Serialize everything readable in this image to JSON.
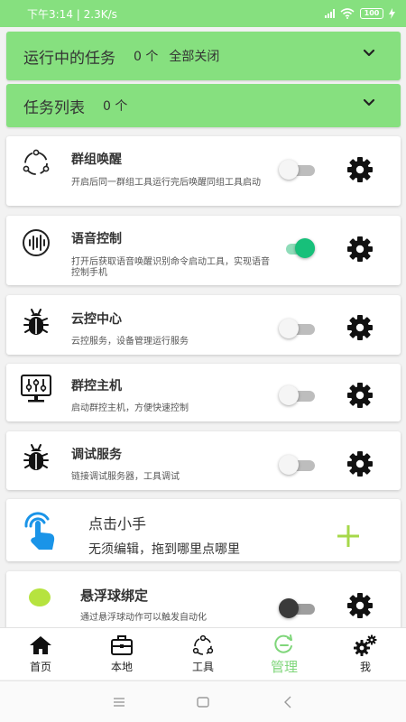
{
  "status_bar": {
    "time_speed": "下午3:14 | 2.3K/s",
    "battery": "100"
  },
  "running_tasks": {
    "title": "运行中的任务",
    "count": "0 个",
    "close_all": "全部关闭"
  },
  "task_list": {
    "title": "任务列表",
    "count": "0 个"
  },
  "cards": [
    {
      "title": "群组唤醒",
      "desc": "开启后同一群组工具运行完后唤醒同组工具启动",
      "toggle": "off",
      "icon": "group-cycle-icon"
    },
    {
      "title": "语音控制",
      "desc": "打开后获取语音唤醒识别命令启动工具，实现语音控制手机",
      "toggle": "on",
      "icon": "voice-wave-icon"
    },
    {
      "title": "云控中心",
      "desc": "云控服务，设备管理运行服务",
      "toggle": "off",
      "icon": "bug-icon"
    },
    {
      "title": "群控主机",
      "desc": "启动群控主机，方便快速控制",
      "toggle": "off",
      "icon": "monitor-sliders-icon"
    },
    {
      "title": "调试服务",
      "desc": "链接调试服务器，工具调试",
      "toggle": "off",
      "icon": "bug-icon"
    },
    {
      "title": "悬浮球绑定",
      "desc": "通过悬浮球动作可以触发自动化",
      "toggle": "off-dark",
      "icon": "green-dot-icon"
    }
  ],
  "tap_card": {
    "title": "点击小手",
    "desc": "无须编辑，拖到哪里点哪里"
  },
  "tabs": [
    {
      "label": "首页",
      "icon": "home-icon"
    },
    {
      "label": "本地",
      "icon": "briefcase-icon"
    },
    {
      "label": "工具",
      "icon": "tools-icon"
    },
    {
      "label": "管理",
      "icon": "manage-icon",
      "active": true
    },
    {
      "label": "我",
      "icon": "gears-icon"
    }
  ],
  "colors": {
    "accent_green": "#86e07f",
    "toggle_on": "#17c07a",
    "plus_green": "#a6d84a"
  }
}
